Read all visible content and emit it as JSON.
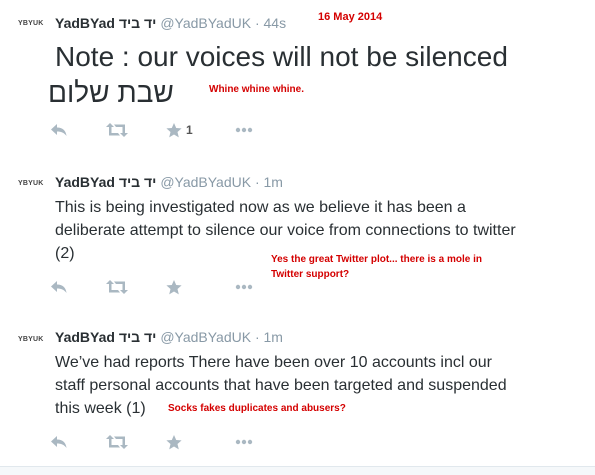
{
  "tweets": [
    {
      "avatar_text": "YBYUK",
      "name": "YadBYad יד ביד",
      "handle": "@YadBYadUK",
      "separator": "·",
      "time": "44s",
      "text_line1": "Note : our voices will not be silenced",
      "text_line2": "שבת שלום",
      "favorite_count": "1"
    },
    {
      "avatar_text": "YBYUK",
      "name": "YadBYad יד ביד",
      "handle": "@YadBYadUK",
      "separator": "·",
      "time": "1m",
      "text_line1": "This is being investigated now as we believe it has been a",
      "text_line2": "deliberate attempt to silence our voice from connections to twitter",
      "text_line3": "(2)"
    },
    {
      "avatar_text": "YBYUK",
      "name": "YadBYad יד ביד",
      "handle": "@YadBYadUK",
      "separator": "·",
      "time": "1m",
      "text_line1": "We’ve had reports There have been over 10 accounts incl our",
      "text_line2": "staff personal accounts that have been targeted and suspended",
      "text_line3": "this week (1)"
    }
  ],
  "annotations": {
    "date": "16 May 2014",
    "note1": "Whine whine whine.",
    "note2_line1": "Yes the great Twitter plot...  there is a mole in",
    "note2_line2": "Twitter support?",
    "note3": "Socks fakes duplicates and abusers?"
  },
  "icons": [
    "reply-icon",
    "retweet-icon",
    "favorite-icon",
    "more-icon"
  ],
  "colors": {
    "annotation": "#d40000",
    "muted": "#8899a6",
    "icon": "#aab8c2",
    "text": "#292f33"
  }
}
